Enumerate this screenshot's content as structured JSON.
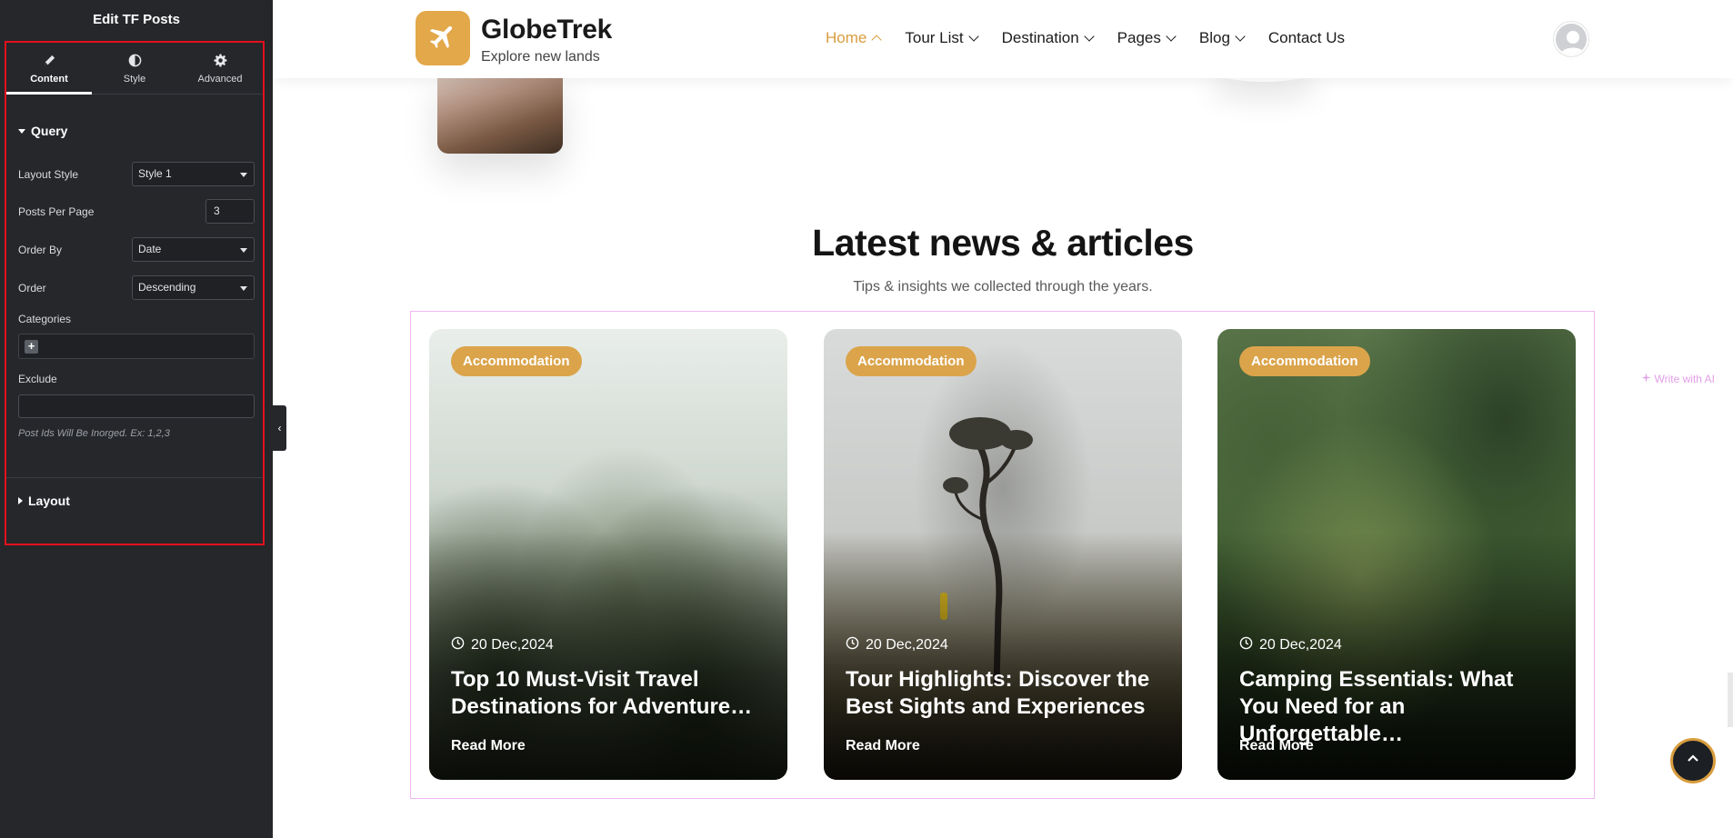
{
  "panel": {
    "title": "Edit TF Posts",
    "tabs": [
      {
        "label": "Content",
        "icon": "pencil-icon"
      },
      {
        "label": "Style",
        "icon": "half-circle-icon"
      },
      {
        "label": "Advanced",
        "icon": "gear-icon"
      }
    ],
    "query": {
      "heading": "Query",
      "layout_style_label": "Layout Style",
      "layout_style_value": "Style 1",
      "posts_per_page_label": "Posts Per Page",
      "posts_per_page_value": "3",
      "order_by_label": "Order By",
      "order_by_value": "Date",
      "order_label": "Order",
      "order_value": "Descending",
      "categories_label": "Categories",
      "categories_add": "+",
      "exclude_label": "Exclude",
      "write_ai": "Write with AI",
      "exclude_help": "Post Ids Will Be Inorged. Ex: 1,2,3"
    },
    "layout_heading": "Layout",
    "highlight_color": "#e5101d"
  },
  "site": {
    "brand_name": "GlobeTrek",
    "brand_tagline": "Explore new lands",
    "accent_color": "#d89d3e",
    "nav": [
      {
        "label": "Home",
        "active": true
      },
      {
        "label": "Tour List"
      },
      {
        "label": "Destination"
      },
      {
        "label": "Pages"
      },
      {
        "label": "Blog"
      },
      {
        "label": "Contact Us"
      }
    ]
  },
  "section": {
    "title": "Latest news & articles",
    "subtitle": "Tips & insights we collected through the years."
  },
  "cards": [
    {
      "badge": "Accommodation",
      "date": "20 Dec,2024",
      "title": "Top 10 Must-Visit Travel Destinations for Adventure…",
      "read_more": "Read More"
    },
    {
      "badge": "Accommodation",
      "date": "20 Dec,2024",
      "title": "Tour Highlights: Discover the Best Sights and Experiences",
      "read_more": "Read More"
    },
    {
      "badge": "Accommodation",
      "date": "20 Dec,2024",
      "title": "Camping Essentials: What You Need for an Unforgettable…",
      "read_more": "Read More"
    }
  ]
}
